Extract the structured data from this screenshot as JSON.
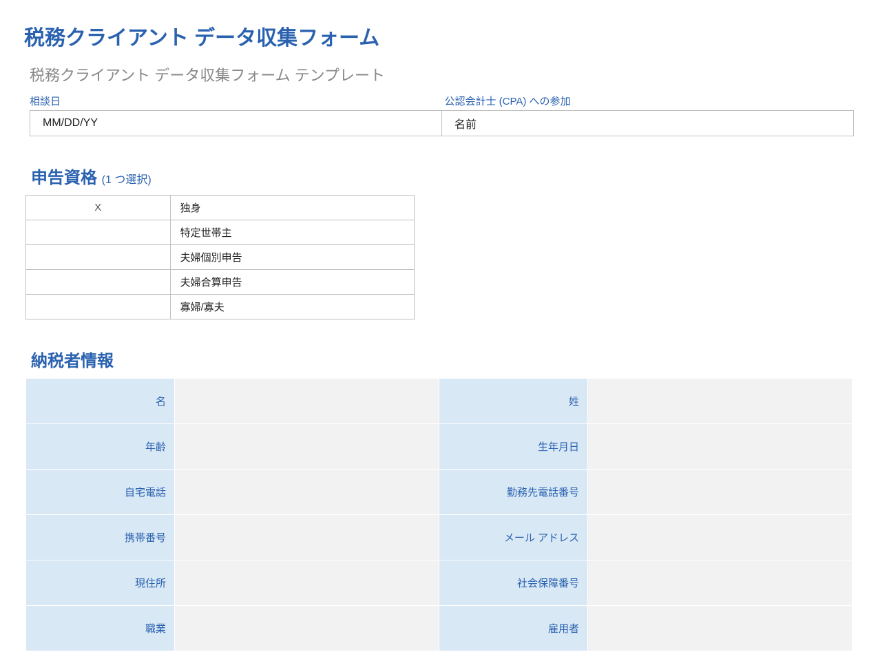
{
  "main_title": "税務クライアント データ収集フォーム",
  "subtitle": "税務クライアント データ収集フォーム テンプレート",
  "header": {
    "consult_label": "相談日",
    "cpa_label": "公認会計士 (CPA) への参加",
    "consult_value": "MM/DD/YY",
    "cpa_value": "名前"
  },
  "filing": {
    "title": "申告資格",
    "hint": "(1 つ選択)",
    "options": [
      {
        "mark": "X",
        "label": "独身"
      },
      {
        "mark": "",
        "label": "特定世帯主"
      },
      {
        "mark": "",
        "label": "夫婦個別申告"
      },
      {
        "mark": "",
        "label": "夫婦合算申告"
      },
      {
        "mark": "",
        "label": "寡婦/寡夫"
      }
    ]
  },
  "taxpayer": {
    "title": "納税者情報",
    "rows": [
      {
        "l1": "名",
        "v1": "",
        "l2": "姓",
        "v2": ""
      },
      {
        "l1": "年齢",
        "v1": "",
        "l2": "生年月日",
        "v2": ""
      },
      {
        "l1": "自宅電話",
        "v1": "",
        "l2": "勤務先電話番号",
        "v2": ""
      },
      {
        "l1": "携帯番号",
        "v1": "",
        "l2": "メール アドレス",
        "v2": ""
      },
      {
        "l1": "現住所",
        "v1": "",
        "l2": "社会保障番号",
        "v2": ""
      },
      {
        "l1": "職業",
        "v1": "",
        "l2": "雇用者",
        "v2": ""
      }
    ]
  }
}
